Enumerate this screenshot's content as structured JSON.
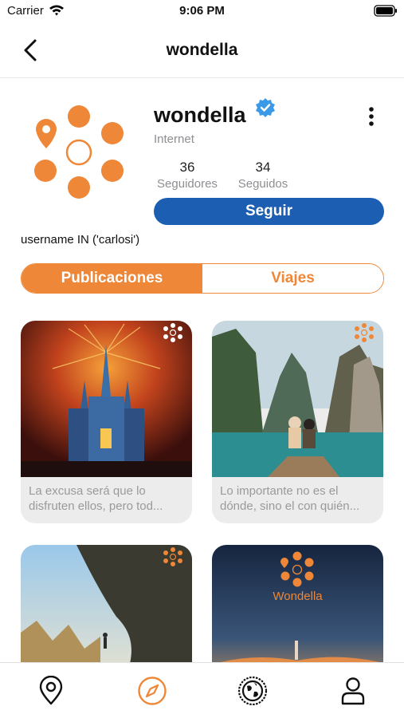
{
  "status_bar": {
    "carrier": "Carrier",
    "time": "9:06 PM"
  },
  "nav": {
    "title": "wondella"
  },
  "profile": {
    "name": "wondella",
    "category": "Internet",
    "followers_count": "36",
    "followers_label": "Seguidores",
    "following_count": "34",
    "following_label": "Seguidos",
    "follow_button": "Seguir",
    "filter_text": "username IN ('carlosi')"
  },
  "tabs": [
    {
      "label": "Publicaciones",
      "active": true
    },
    {
      "label": "Viajes",
      "active": false
    }
  ],
  "posts": [
    {
      "image": "castle-fireworks",
      "caption_line1": "La excusa será que lo",
      "caption_line2": "disfruten ellos, pero tod..."
    },
    {
      "image": "boat-cliffs",
      "caption_line1": "Lo importante no es el",
      "caption_line2": "dónde, sino el con quién..."
    },
    {
      "image": "cave-sunlight"
    },
    {
      "image": "wondella-promo",
      "overlay_text": "Wondella"
    }
  ],
  "tab_bar": [
    {
      "icon": "location-pin-icon",
      "active": false
    },
    {
      "icon": "compass-icon",
      "active": true
    },
    {
      "icon": "globe-icon",
      "active": false
    },
    {
      "icon": "person-icon",
      "active": false
    }
  ],
  "colors": {
    "accent": "#ee8737",
    "follow_blue": "#1c5fb2",
    "verified_blue": "#3a9ae8",
    "caption_gray": "#9a9a9a"
  }
}
